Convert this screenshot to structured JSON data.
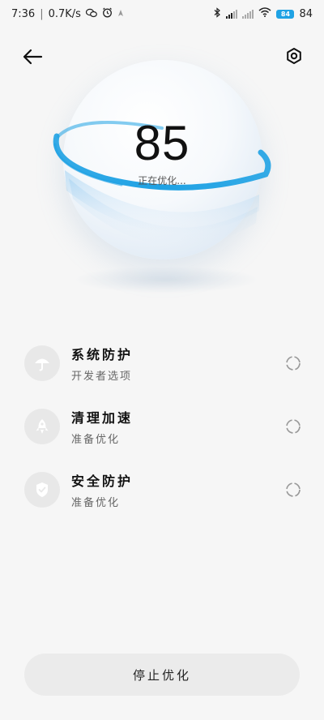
{
  "status_bar": {
    "time": "7:36",
    "net_speed": "0.7K/s",
    "battery": "84",
    "icons": [
      "wechat-icon",
      "alarm-icon",
      "location-icon",
      "bluetooth-icon",
      "signal-icon",
      "signal-icon",
      "wifi-icon",
      "battery-icon"
    ]
  },
  "top_bar": {
    "back_icon": "back-arrow-icon",
    "settings_icon": "settings-icon"
  },
  "optimization": {
    "score": "85",
    "status": "正在优化..."
  },
  "tasks": [
    {
      "title": "系统防护",
      "subtitle": "开发者选项",
      "icon": "umbrella-icon"
    },
    {
      "title": "清理加速",
      "subtitle": "准备优化",
      "icon": "rocket-icon"
    },
    {
      "title": "安全防护",
      "subtitle": "准备优化",
      "icon": "shield-icon"
    }
  ],
  "stop_button": {
    "label": "停止优化"
  },
  "colors": {
    "accent": "#1fa2e4",
    "background": "#f6f6f6",
    "icon_bg": "#e8e8e8",
    "icon_fg": "#ffffff"
  }
}
